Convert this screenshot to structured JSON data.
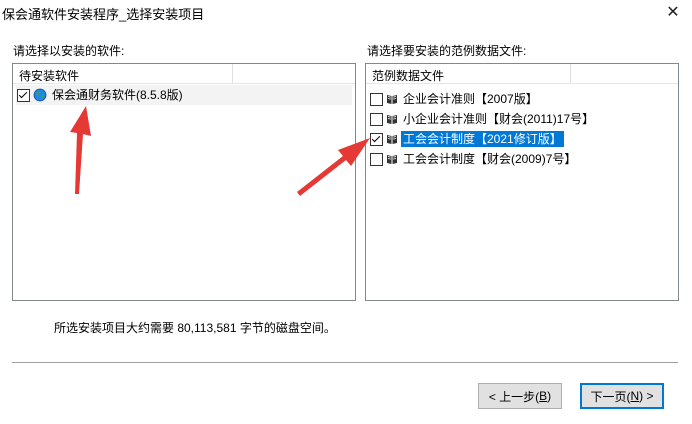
{
  "window": {
    "title": "保会通软件安装程序_选择安装项目",
    "close_glyph": "✕"
  },
  "left": {
    "label": "请选择以安装的软件:",
    "header": "待安装软件",
    "items": [
      {
        "label": "保会通财务软件(8.5.8版)",
        "checked": true
      }
    ]
  },
  "right": {
    "label": "请选择要安装的范例数据文件:",
    "header": "范例数据文件",
    "items": [
      {
        "label": "企业会计准则【2007版】",
        "checked": false,
        "selected": false
      },
      {
        "label": "小企业会计准则【财会(2011)17号】",
        "checked": false,
        "selected": false
      },
      {
        "label": "工会会计制度【2021修订版】",
        "checked": true,
        "selected": true
      },
      {
        "label": "工会会计制度【财会(2009)7号】",
        "checked": false,
        "selected": false
      }
    ]
  },
  "status": "所选安装项目大约需要 80,113,581 字节的磁盘空间。",
  "buttons": {
    "back_prefix": "< 上一步(",
    "back_key": "B",
    "back_suffix": ")",
    "next_prefix": "下一页(",
    "next_key": "N",
    "next_suffix": ") >"
  },
  "colors": {
    "selection": "#0078d7",
    "annotation_arrow": "#e53935",
    "default_button_border": "#0078d7"
  }
}
